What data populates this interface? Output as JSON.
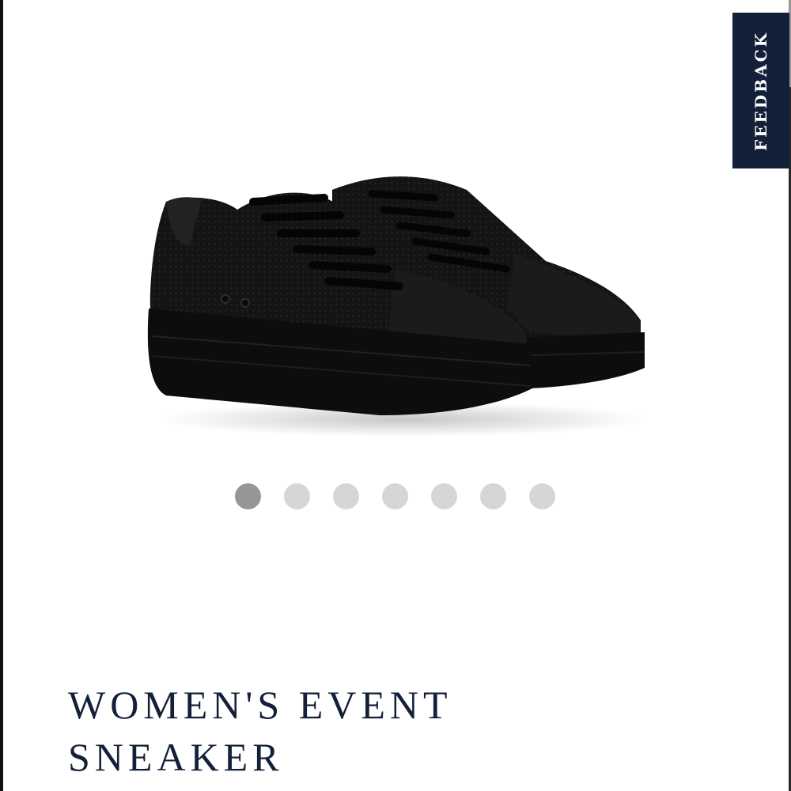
{
  "feedback_tab": {
    "label": "FEEDBACK",
    "background": "#13203a"
  },
  "product_image": {
    "description_icon": "black-sneaker-pair-image"
  },
  "carousel": {
    "total_slides": 7,
    "active_index": 0
  },
  "product": {
    "title_line1": "WOMEN'S EVENT",
    "title_line2": "SNEAKER"
  },
  "colors": {
    "title": "#13203a",
    "dot_active": "#969696",
    "dot_inactive": "#d6d6d6"
  }
}
